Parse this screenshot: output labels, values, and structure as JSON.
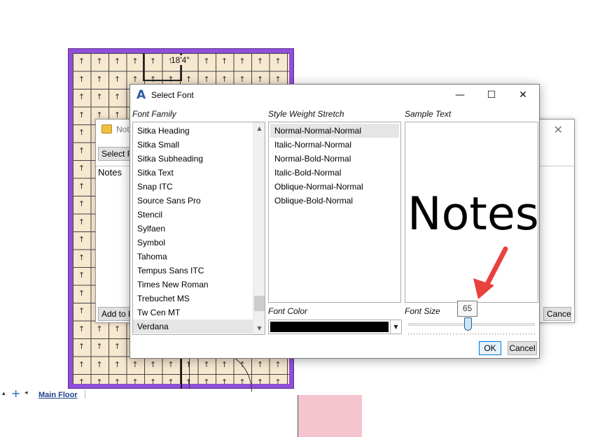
{
  "floor_plan": {
    "dimension_label": "18'4\"",
    "tile_arrow": "↑",
    "colors": {
      "wall": "#8f4fd8",
      "floor": "#f7e8d0",
      "accent_room": "#f5c5cf"
    }
  },
  "floor_tabs": {
    "up_icon": "▴",
    "add_icon": "+",
    "left_icon": "◂",
    "active_tab": "Main Floor"
  },
  "notes_dialog": {
    "title": "Notes",
    "close_icon": "✕",
    "select_font_button": "Select Font",
    "notes_label": "Notes",
    "add_button": "Add to Plan",
    "cancel_button": "Cancel"
  },
  "font_dialog": {
    "title": "Select Font",
    "minimize_icon": "—",
    "maximize_icon": "☐",
    "close_icon": "✕",
    "font_family_label": "Font Family",
    "style_label": "Style Weight Stretch",
    "sample_label": "Sample Text",
    "font_color_label": "Font Color",
    "font_size_label": "Font Size",
    "font_families": [
      "Sitka Heading",
      "Sitka Small",
      "Sitka Subheading",
      "Sitka Text",
      "Snap ITC",
      "Source Sans Pro",
      "Stencil",
      "Sylfaen",
      "Symbol",
      "Tahoma",
      "Tempus Sans ITC",
      "Times New Roman",
      "Trebuchet MS",
      "Tw Cen MT",
      "Verdana"
    ],
    "selected_family": "Verdana",
    "styles": [
      "Normal-Normal-Normal",
      "Italic-Normal-Normal",
      "Normal-Bold-Normal",
      "Italic-Bold-Normal",
      "Oblique-Normal-Normal",
      "Oblique-Bold-Normal"
    ],
    "selected_style": "Normal-Normal-Normal",
    "sample_text": "Notes",
    "font_color": "#000000",
    "font_size": "65",
    "font_size_slider_fraction": 0.47,
    "ok_button": "OK",
    "cancel_button": "Cancel",
    "scroll_up_icon": "▲",
    "scroll_down_icon": "▼",
    "dropdown_icon": "▼"
  },
  "annotation": {
    "arrow_color": "#e8413e"
  }
}
